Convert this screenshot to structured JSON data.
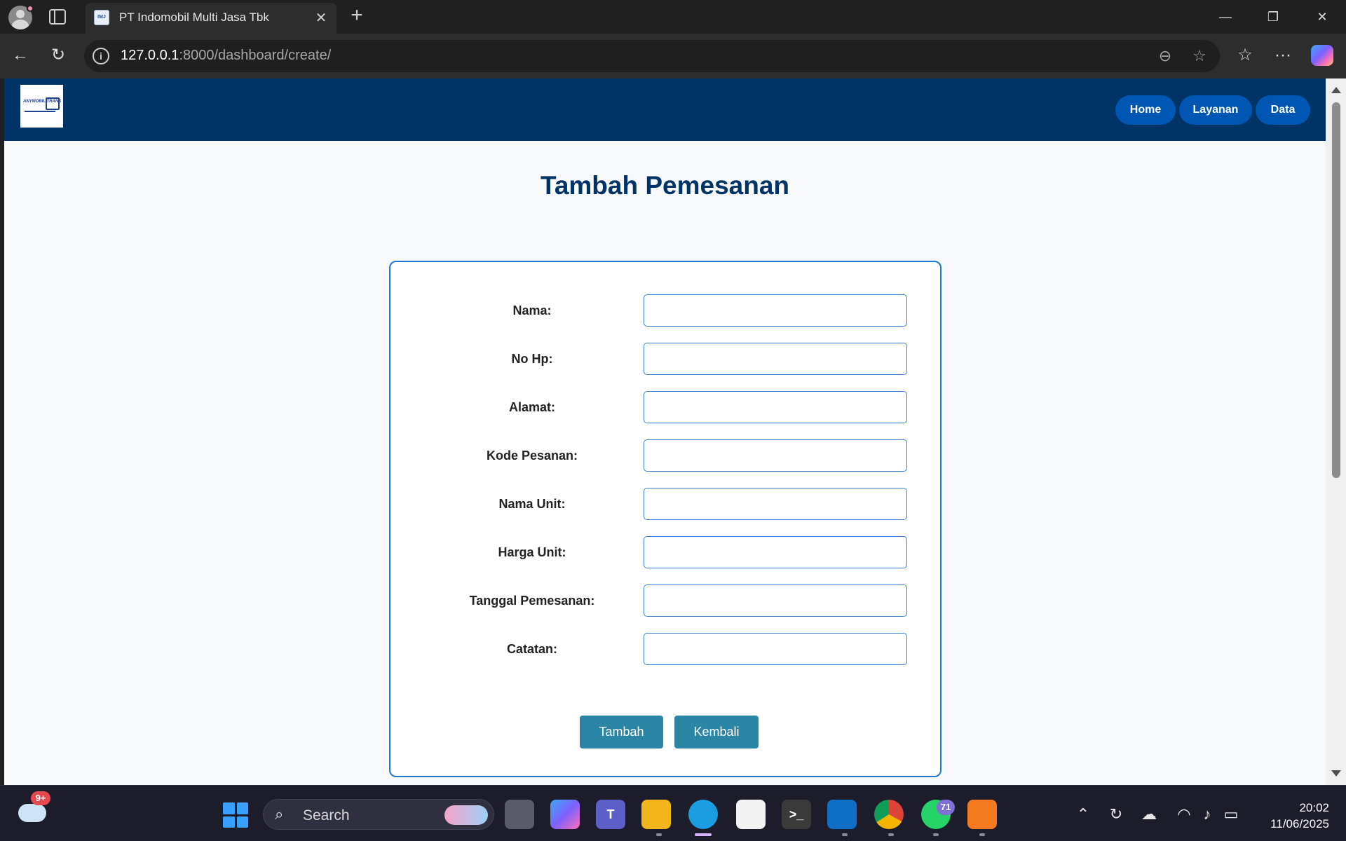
{
  "browser": {
    "tab_title": "PT Indomobil Multi Jasa Tbk",
    "tab_favicon_text": "IMJ",
    "url_host": "127.0.0.1",
    "url_rest": ":8000/dashboard/create/"
  },
  "site": {
    "logo_text": "ANYMOBIL TRANS",
    "nav": [
      {
        "label": "Home"
      },
      {
        "label": "Layanan"
      },
      {
        "label": "Data"
      }
    ]
  },
  "page": {
    "title": "Tambah Pemesanan"
  },
  "form": {
    "fields": [
      {
        "label": "Nama:",
        "value": ""
      },
      {
        "label": "No Hp:",
        "value": ""
      },
      {
        "label": "Alamat:",
        "value": ""
      },
      {
        "label": "Kode Pesanan:",
        "value": ""
      },
      {
        "label": "Nama Unit:",
        "value": ""
      },
      {
        "label": "Harga Unit:",
        "value": ""
      },
      {
        "label": "Tanggal Pemesanan:",
        "value": ""
      },
      {
        "label": "Catatan:",
        "value": ""
      }
    ],
    "submit_label": "Tambah",
    "back_label": "Kembali"
  },
  "taskbar": {
    "weather_badge": "9+",
    "search_label": "Search",
    "whatsapp_badge": "71",
    "time": "20:02",
    "date": "11/06/2025"
  }
}
